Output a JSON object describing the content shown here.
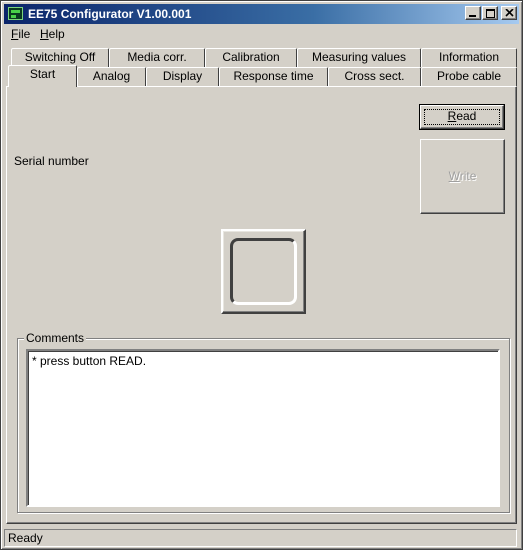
{
  "window": {
    "title": "EE75 Configurator V1.00.001"
  },
  "menu": {
    "file": {
      "accel": "F",
      "rest": "ile"
    },
    "help": {
      "accel": "H",
      "rest": "elp"
    }
  },
  "tabs": {
    "row_back": [
      "Switching Off",
      "Media corr.",
      "Calibration",
      "Measuring values",
      "Information"
    ],
    "row_front": [
      "Start",
      "Analog",
      "Display",
      "Response time",
      "Cross sect.",
      "Probe cable"
    ],
    "active": "Start"
  },
  "start": {
    "read_button": {
      "accel": "R",
      "rest": "ead"
    },
    "write_button": {
      "accel": "W",
      "rest": "rite"
    },
    "serial_label": "Serial number",
    "comments_label": "Comments",
    "comments_text": "* press button READ."
  },
  "status": {
    "text": "Ready"
  },
  "colors": {
    "face": "#d4d0c8",
    "title_start": "#0a246a",
    "title_end": "#a6caf0"
  }
}
